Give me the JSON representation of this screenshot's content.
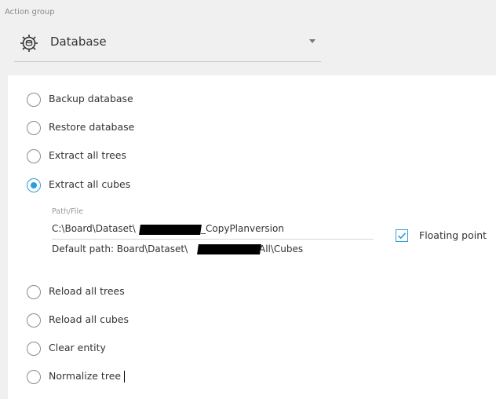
{
  "action_group": {
    "label": "Action group",
    "value": "Database",
    "icon": "database-gear-icon"
  },
  "options": [
    {
      "label": "Backup database",
      "checked": false
    },
    {
      "label": "Restore database",
      "checked": false
    },
    {
      "label": "Extract all trees",
      "checked": false
    },
    {
      "label": "Extract all cubes",
      "checked": true
    },
    {
      "label": "Reload all trees",
      "checked": false
    },
    {
      "label": "Reload all cubes",
      "checked": false
    },
    {
      "label": "Clear entity",
      "checked": false
    },
    {
      "label": "Normalize tree",
      "checked": false
    }
  ],
  "path_file": {
    "label": "Path/File",
    "value_prefix": "C:\\Board\\Dataset\\",
    "value_suffix": "_CopyPlanversion",
    "default_path_prefix": "Default path: Board\\Dataset\\",
    "default_path_suffix": "All\\Cubes"
  },
  "floating_point": {
    "label": "Floating point",
    "checked": true
  },
  "colors": {
    "accent": "#2d9cdb",
    "background": "#f0f0f0",
    "panel": "#ffffff"
  }
}
